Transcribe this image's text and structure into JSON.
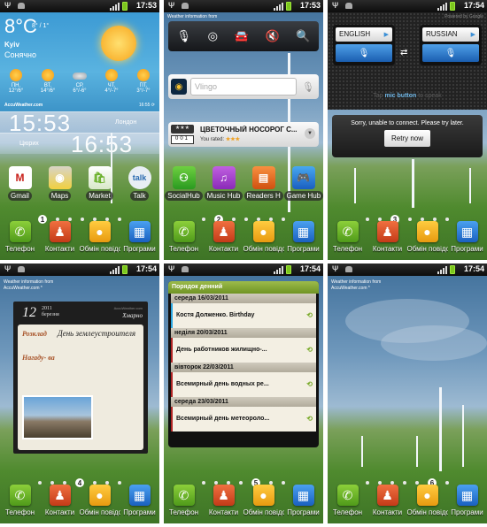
{
  "dock": {
    "items": [
      {
        "label": "Телефон",
        "icon": "phone-icon",
        "glyph": "✆"
      },
      {
        "label": "Контакти",
        "icon": "contact-icon",
        "glyph": "👤"
      },
      {
        "label": "Обмін повідо",
        "icon": "message-icon",
        "glyph": "💬"
      },
      {
        "label": "Програми",
        "icon": "apps-grid-icon",
        "glyph": "▦"
      }
    ]
  },
  "screens": [
    {
      "status_time": "17:53",
      "page": "1",
      "weather": {
        "temp": "8°C",
        "hilo": "8° / 1°",
        "city": "Kyiv",
        "condition": "Сонячно",
        "forecast": [
          {
            "day": "ПН.",
            "range": "12°/6°"
          },
          {
            "day": "ВТ.",
            "range": "14°/6°"
          },
          {
            "day": "СР.",
            "range": "6°/-6°"
          },
          {
            "day": "ЧТ.",
            "range": "4°/-7°"
          },
          {
            "day": "ПТ.",
            "range": "3°/-7°"
          }
        ],
        "source": "AccuWeather.com",
        "updated": "16:55"
      },
      "clocks": [
        {
          "time": "15:53",
          "city": "Лондон"
        },
        {
          "time": "16:53",
          "city": "Цюрих"
        }
      ],
      "apps": [
        "Gmail",
        "Maps",
        "Market",
        "Talk"
      ]
    },
    {
      "status_time": "17:53",
      "page": "2",
      "weather_src": "Weather information from",
      "vlingo_placeholder": "Vlingo",
      "music": {
        "title": "ЦВЕТОЧНЫЙ НОСОРОГ С...",
        "rated_label": "You rated:",
        "stars": "★★★",
        "counter": "001"
      },
      "apps": [
        "SocialHub",
        "Music Hub",
        "Readers H",
        "Game Hub"
      ]
    },
    {
      "status_time": "17:54",
      "page": "3",
      "powered": "Powered by Google",
      "lang_from": "ENGLISH",
      "lang_to": "RUSSIAN",
      "tap_pre": "Tap ",
      "tap_bold": "mic button",
      "tap_post": " to speak",
      "error": "Sorry, unable to connect. Please try later.",
      "retry": "Retry now"
    },
    {
      "status_time": "17:54",
      "page": "4",
      "weather_src_1": "Weather information from",
      "weather_src_2": "AccuWeather.com *",
      "diary": {
        "day": "12",
        "year": "2011",
        "month": "березня",
        "source": "AccuWeather.com",
        "condition": "Хмарно",
        "schedule_label": "Розклад",
        "schedule_text": "День землеустроителя",
        "reminder_label": "Нагаду- ва"
      }
    },
    {
      "status_time": "17:54",
      "page": "5",
      "agenda": {
        "title": "Порядок денний",
        "groups": [
          {
            "date": "середа 16/03/2011",
            "event": "Костя Долженко. Birthday",
            "color": "#2aa6e0"
          },
          {
            "date": "неділя 20/03/2011",
            "event": "День работников жилищно-...",
            "color": "#b02424"
          },
          {
            "date": "вівторок 22/03/2011",
            "event": "Всемирный день водных ре...",
            "color": "#b02424"
          },
          {
            "date": "середа 23/03/2011",
            "event": "Всемирный день метеороло...",
            "color": "#b02424"
          }
        ]
      }
    },
    {
      "status_time": "17:54",
      "page": "6",
      "weather_src_1": "Weather information from",
      "weather_src_2": "AccuWeather.com *"
    }
  ]
}
